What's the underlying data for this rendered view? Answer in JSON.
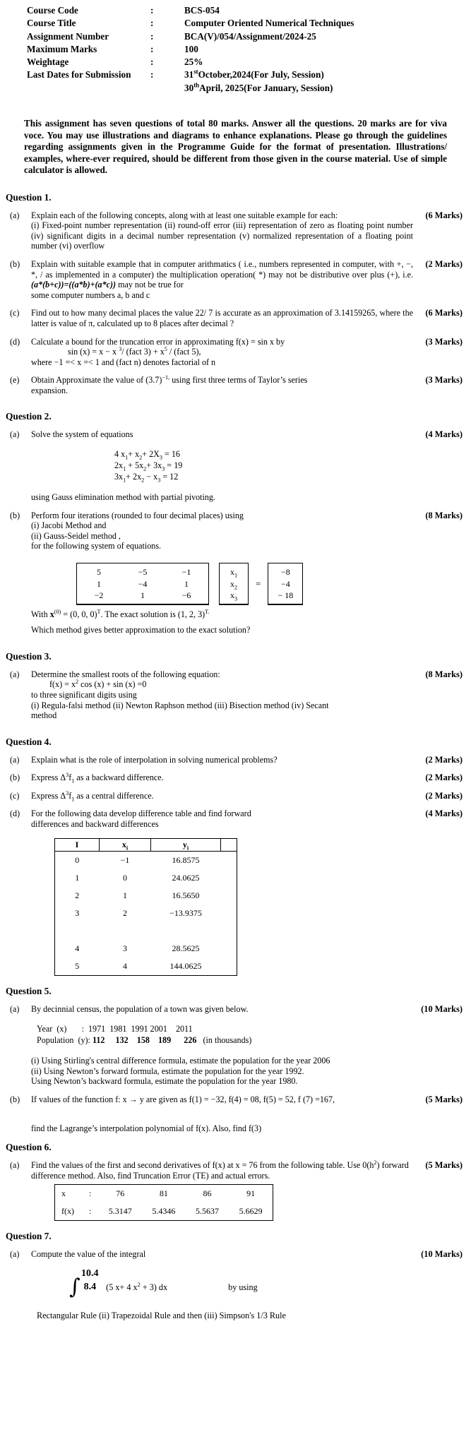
{
  "header": {
    "rows": [
      {
        "label": "Course Code",
        "colon": ":",
        "value": "BCS-054"
      },
      {
        "label": "Course Title",
        "colon": ":",
        "value": "Computer Oriented Numerical Techniques"
      },
      {
        "label": "Assignment Number",
        "colon": ":",
        "value": "BCA(V)/054/Assignment/2024-25"
      },
      {
        "label": "Maximum Marks",
        "colon": ":",
        "value": "100"
      },
      {
        "label": "Weightage",
        "colon": ":",
        "value": "25%"
      },
      {
        "label": "Last Dates for Submission",
        "colon": ":",
        "value": "31stOctober,2024(For July, Session)"
      }
    ],
    "submission_date_1_num": "31",
    "submission_date_1_sup": "st",
    "submission_date_1_rest": "October,2024(For July, Session)",
    "submission_date_2_num": "30",
    "submission_date_2_sup": "th",
    "submission_date_2_rest": "April, 2025(For January, Session)"
  },
  "intro": "This assignment has seven questions of total 80 marks. Answer all the questions. 20 marks are for viva voce. You may use illustrations and diagrams to enhance explanations. Please go through the guidelines regarding assignments given in the Programme Guide for the format of presentation. Illustrations/ examples, where-ever required, should be different from those given in the course material. Use of simple calculator is allowed.",
  "q1": {
    "title": "Question 1.",
    "a": {
      "label": "(a)",
      "text": "Explain each of the following concepts, along with at least one suitable example for each:",
      "detail": "(i) Fixed-point number representation (ii) round-off error (iii) representation of zero as floating point number (iv) significant digits in a decimal number representation (v) normalized representation of a floating point number (vi)  overflow",
      "marks": "(6 Marks)"
    },
    "b": {
      "label": "(b)",
      "text": " Explain with suitable example  that in  computer arithmatics  ( i.e., numbers represented in computer, with +, −, *, / as implemented  in a computer) the multiplication operation( *) may not be distributive over plus (+), i.e. ",
      "formula": "(a*(b+c))=((a*b)+(a*c))",
      "text2": " may not be true for",
      "text3": "some computer numbers a, b and  c",
      "marks": "(2 Marks)"
    },
    "c": {
      "label": "(c)",
      "text": "Find out to how many decimal places the  value  22/ 7  is accurate as an approximation  of  3.14159265, where the latter  is value   of ",
      "pi": "π",
      "text2": ", calculated up to 8 places after decimal ?",
      "marks": "(6 Marks)"
    },
    "d": {
      "label": "(d)",
      "text": "Calculate a bound for the truncation error in approximating f(x) = sin x by",
      "formula": "sin (x)  =  x − x 3/  (fact 3)  + x5 / (fact 5),",
      "formula_parts": {
        "pre": "sin (x)  =  x − x ",
        "sup1": "3",
        "mid": "/  (fact 3)  + x",
        "sup2": "5",
        "post": " / (fact 5),"
      },
      "where": "where  −1  =<  x  =< 1  and  (fact n) denotes factorial of n",
      "marks": "(3 Marks)"
    },
    "e": {
      "label": "(e)",
      "text_pre": "Obtain Approximate the value of  (3.7)",
      "sup": "−1,",
      "text_post": " using first three terms of Taylor’s series",
      "text2": "expansion.",
      "marks": "(3 Marks)"
    }
  },
  "q2": {
    "title": "Question 2.",
    "a": {
      "label": "(a)",
      "text": "Solve the system of equations",
      "marks": "(4 Marks)",
      "equations": [
        {
          "pre": "4 x",
          "s1": "1",
          "mid": "+ x",
          "s2": "2",
          "mid2": "+  2X",
          "s3": "3",
          "post": " = 16"
        },
        {
          "pre": "2x",
          "s1": "1",
          "mid": " + 5x",
          "s2": "2",
          "mid2": "+ 3x",
          "s3": "3",
          "post": " = 19"
        },
        {
          "pre": "3x",
          "s1": "1",
          "mid": "+ 2x",
          "s2": "2",
          "mid2": " − x",
          "s3": "3",
          "post": " = 12"
        }
      ],
      "note": "using Gauss elimination method with partial pivoting."
    },
    "b": {
      "label": "(b)",
      "text": "Perform four iterations (rounded to four decimal places) using",
      "line1": "(i)  Jacobi Method and",
      "line2": "(ii) Gauss-Seidel method ,",
      "line3": "for the following system of equations.",
      "marks": "(8 Marks)",
      "matrix_a": [
        [
          "5",
          "−5",
          "−1"
        ],
        [
          "1",
          "−4",
          "1"
        ],
        [
          "−2",
          "1",
          "−6"
        ]
      ],
      "matrix_x": [
        [
          "x",
          "1"
        ],
        [
          "x",
          "2"
        ],
        [
          "x",
          "3"
        ]
      ],
      "matrix_b": [
        "−8",
        "−4",
        "− 18"
      ],
      "equals": "=",
      "with_pre": "With  ",
      "with_x": "x",
      "with_sup": "(0)",
      "with_rest": " = (0, 0, 0)",
      "with_t": "T",
      "with_rest2": ".  The exact solution is (1, 2, 3)",
      "with_t2": "T.",
      "question": "Which method gives better approximation to the exact solution?"
    }
  },
  "q3": {
    "title": "Question 3.",
    "a": {
      "label": "(a)",
      "text": "Determine the smallest roots of the following equation:",
      "formula_pre": "f(x) = x",
      "formula_sup": "2",
      "formula_post": " cos (x) + sin (x) =0",
      "line2": "to three significant digits using",
      "line3": "(i) Regula-falsi method (ii)    Newton   Raphson method   (iii) Bisection method (iv) Secant",
      "line4": "method",
      "marks": "(8 Marks)"
    }
  },
  "q4": {
    "title": "Question 4.",
    "a": {
      "label": "(a)",
      "text": "Explain what is the role of interpolation in solving numerical problems?",
      "marks": "(2 Marks)"
    },
    "b": {
      "label": "(b)",
      "pre": "Express ",
      "delta": "Δ",
      "sup": "3",
      "f": "f",
      "sub": "1",
      "post": " as a backward difference.",
      "marks": "(2 Marks)"
    },
    "c": {
      "label": "(c)",
      "pre": "Express ",
      "delta": "Δ",
      "sup": "3",
      "f": "f",
      "sub": "1",
      "post": " as a central difference.",
      "marks": "(2 Marks)"
    },
    "d": {
      "label": "(d)",
      "text": "For the following data develop difference table and find forward",
      "text2": "differences and backward differences",
      "marks": "(4 Marks)",
      "table": {
        "headers": [
          "I",
          "x",
          "y",
          ""
        ],
        "header_subs": [
          "",
          "i",
          "i",
          ""
        ],
        "rows": [
          {
            "i": "0",
            "x": "−1",
            "y": "16.8575",
            "bold": false
          },
          {
            "i": "1",
            "x": "0",
            "y": "24.0625",
            "bold": false
          },
          {
            "i": "2",
            "x": "1",
            "y": "16.5650",
            "bold": false
          },
          {
            "i": "3",
            "x": "2",
            "y": "−13.9375",
            "bold": false
          },
          {
            "i": "",
            "x": "",
            "y": "",
            "bold": false
          },
          {
            "i": "4",
            "x": "3",
            "y": "28.5625",
            "bold": false
          },
          {
            "i": "5",
            "x": "4",
            "y": "144.0625",
            "bold": true
          }
        ]
      }
    }
  },
  "q5": {
    "title": "Question 5.",
    "a": {
      "label": "(a)",
      "text": "By decinnial census, the population of a town was given below.",
      "marks": "(10 Marks)",
      "year_label": "Year  (x)       :  1971  1981  1991 2001    2011",
      "pop_label": "Population  (y):",
      "pop_values": "112     132    158    189      226",
      "pop_unit": "(in thousands)",
      "year_header": "Year  (x)",
      "years": [
        "1971",
        "1981",
        "1991",
        "2001",
        "2011"
      ],
      "populations": [
        "112",
        "132",
        "158",
        "189",
        "226"
      ],
      "items": [
        "(i)   Using Stirling's central difference formula, estimate the population for the year  2006",
        "(ii)  Using Newton’s forward formula, estimate the population for the year 1992.",
        " Using Newton’s backward formula, estimate the population for the year 1980."
      ]
    },
    "b": {
      "label": "(b)",
      "text": "If values of the function f: x → y  are given as f(1) = −32, f(4) = 08, f(5) = 52,  f (7) =167,",
      "marks": "(5 Marks)",
      "text2": "find  the Lagrange’s interpolation polynomial of f(x). Also, find f(3)"
    }
  },
  "q6": {
    "title": "Question 6.",
    "a": {
      "label": "(a)",
      "text_pre": "Find the values of the first and second derivatives of f(x) at   x = 76 from the   following table.  Use 0(h",
      "sup": "2",
      "text_post": ") forward difference method.  Also, find  Truncation Error (TE) and  actual errors.",
      "marks": "(5 Marks)",
      "table": {
        "row1_label": "x",
        "row1_colon": ":",
        "row1_values": [
          "76",
          "81",
          "86",
          "91"
        ],
        "row2_label": "f(x)",
        "row2_colon": ":",
        "row2_values": [
          "5.3147",
          "5.4346",
          "5.5637",
          "5.6629"
        ]
      }
    }
  },
  "q7": {
    "title": "Question 7.",
    "a": {
      "label": "(a)",
      "text": "Compute the value of the integral",
      "marks": "(10 Marks)",
      "upper_limit": "10.4",
      "integral_sign": "∫",
      "lower_limit": "8.4",
      "expr_pre": "(5 x+ 4 x",
      "expr_sup": "2",
      "expr_post": " + 3)  dx",
      "by_using": "by using",
      "final": "Rectangular Rule (ii) Trapezoidal Rule and then (iii) Simpson's 1/3 Rule"
    }
  }
}
